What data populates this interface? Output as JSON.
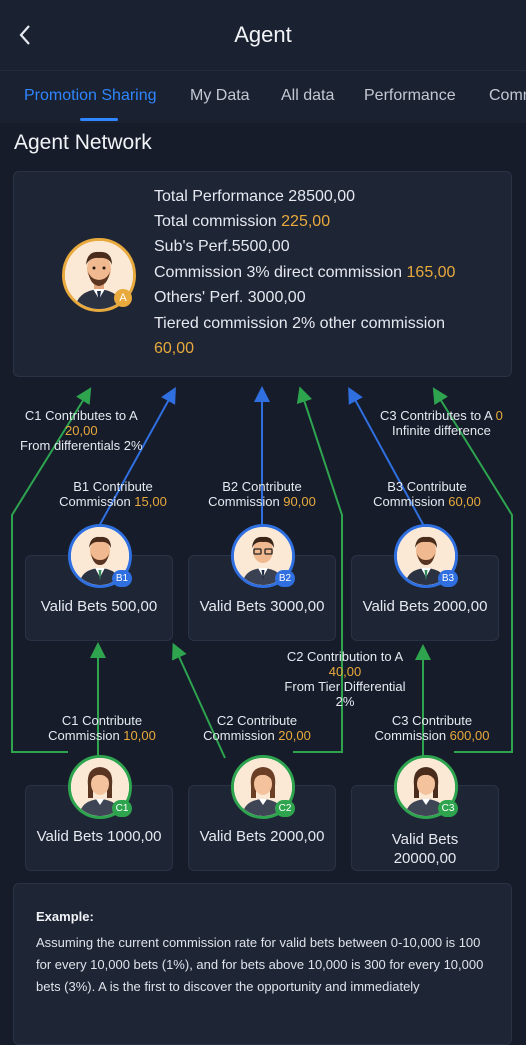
{
  "header": {
    "title": "Agent"
  },
  "tabs": [
    "Promotion Sharing",
    "My Data",
    "All data",
    "Performance",
    "Comm"
  ],
  "section_title": "Agent Network",
  "agent_a": {
    "badge": "A",
    "total_performance": "Total Performance 28500,00",
    "total_commission_label": "Total commission ",
    "total_commission_value": "225,00",
    "subs_perf": "Sub's Perf.5500,00",
    "direct_label": "Commission 3% direct commission ",
    "direct_value": "165,00",
    "others_perf": "Others' Perf. 3000,00",
    "tiered_label": "Tiered commission 2% other commission",
    "tiered_value": "60,00"
  },
  "annotations": {
    "c1_to_a_line1": "C1 Contributes to A",
    "c1_to_a_value": "20,00",
    "c1_to_a_line3": "From differentials 2%",
    "c3_to_a_line1": "C3 Contributes to A ",
    "c3_to_a_value": "0",
    "c3_to_a_line2": "Infinite difference",
    "c2_to_a_line1": "C2 Contribution to A",
    "c2_to_a_value": "40,00",
    "c2_to_a_line3": "From Tier Differential",
    "c2_to_a_line4": "2%"
  },
  "b_nodes": [
    {
      "badge": "B1",
      "contrib_line1": "B1 Contribute",
      "contrib_label": "Commission ",
      "contrib_value": "15,00",
      "valid_bets": "Valid Bets 500,00"
    },
    {
      "badge": "B2",
      "contrib_line1": "B2 Contribute",
      "contrib_label": "Commission ",
      "contrib_value": "90,00",
      "valid_bets": "Valid Bets 3000,00"
    },
    {
      "badge": "B3",
      "contrib_line1": "B3 Contribute",
      "contrib_label": "Commission ",
      "contrib_value": "60,00",
      "valid_bets": "Valid Bets 2000,00"
    }
  ],
  "c_nodes": [
    {
      "badge": "C1",
      "contrib_line1": "C1 Contribute",
      "contrib_label": "Commission ",
      "contrib_value": "10,00",
      "valid_bets": "Valid Bets 1000,00"
    },
    {
      "badge": "C2",
      "contrib_line1": "C2 Contribute",
      "contrib_label": "Commission ",
      "contrib_value": "20,00",
      "valid_bets": "Valid Bets 2000,00"
    },
    {
      "badge": "C3",
      "contrib_line1": "C3 Contribute",
      "contrib_label": "Commission ",
      "contrib_value": "600,00",
      "valid_bets_line1": "Valid Bets",
      "valid_bets_line2": "20000,00"
    }
  ],
  "example": {
    "title": "Example:",
    "text": "Assuming the current commission rate for valid bets between 0-10,000 is 100 for every 10,000 bets (1%), and for bets above 10,000 is 300 for every 10,000 bets (3%). A is the first to discover the opportunity and immediately"
  },
  "colors": {
    "background": "#161c2a",
    "card": "#1e2535",
    "accent_blue": "#2f86ff",
    "gold": "#e8a93d",
    "green": "#2ea44f",
    "line_blue": "#2f6fe0"
  },
  "icons": {
    "back": "chevron-left-icon",
    "avatar": "avatar-icon"
  }
}
